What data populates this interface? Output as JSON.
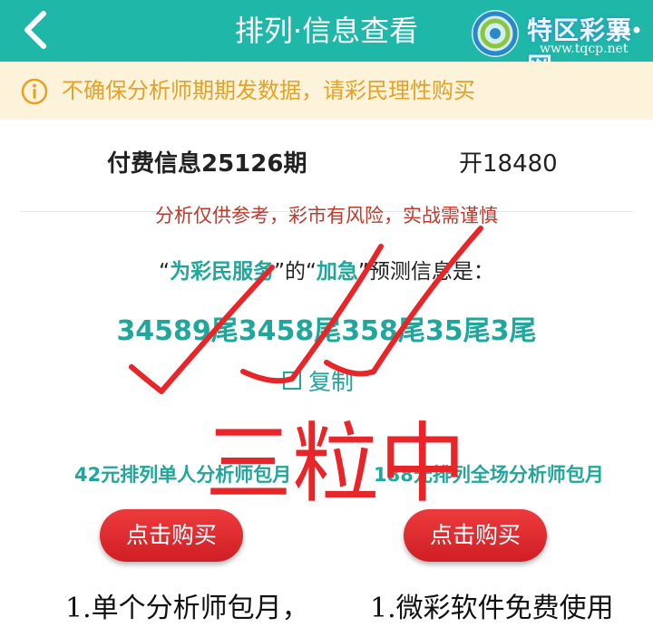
{
  "header": {
    "title": "排列·信息查看",
    "watermark_brand": "特区彩票网",
    "watermark_url": "www.tqcp.net"
  },
  "notice": {
    "text": "不确保分析师期期发数据，请彩民理性购买"
  },
  "info": {
    "issue_title": "付费信息25126期",
    "open_number": "开18480",
    "risk_warning": "分析仅供参考，彩市有风险，实战需谨慎",
    "predict_prefix": "“",
    "analyst_name": "为彩民服务",
    "predict_mid": "”的“",
    "category": "加急",
    "predict_suffix": "”预测信息是：",
    "result": "34589尾3458尾358尾35尾3尾",
    "copy_label": "复制"
  },
  "plans": {
    "left_title": "42元排列单人分析师包月",
    "right_title": "188元排列全场分析师包月",
    "buy_label": "点击购买",
    "left_feature": "1.单个分析师包月，",
    "right_feature": "1.微彩软件免费使用"
  },
  "annotation": {
    "text": "三粒中",
    "color": "#e8262a"
  },
  "colors": {
    "accent": "#1fb7a8",
    "notice_bg": "#fcf3da",
    "notice_text": "#e6a126",
    "warning": "#c0392b",
    "button": "#e02a2e"
  },
  "icons": {
    "back": "chevron-left-icon",
    "info": "info-circle-icon",
    "menu": "more-dots-icon",
    "copy": "copy-square-icon",
    "logo": "swirl-logo-icon"
  }
}
